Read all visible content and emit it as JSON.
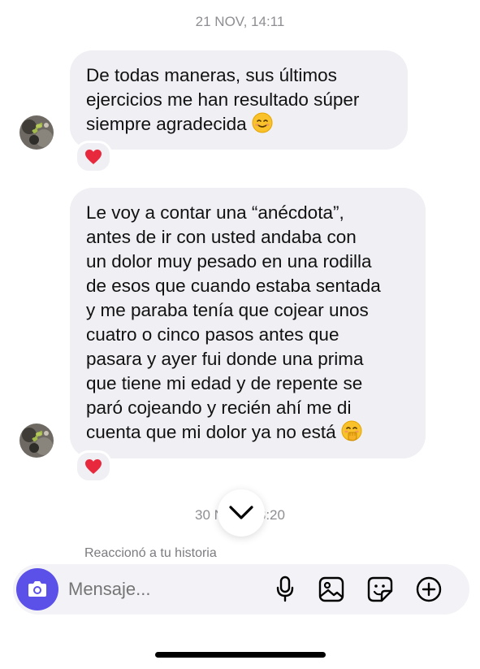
{
  "timestamps": {
    "first": "21 NOV, 14:11",
    "second": "30 NOV, 13:20"
  },
  "messages": [
    {
      "lines": [
        "De todas maneras, sus últimos",
        "ejercicios me han resultado súper",
        "siempre agradecida"
      ],
      "trailing_emoji": "smiling-face-emoji",
      "reaction": "❤️"
    },
    {
      "lines": [
        "Le voy a contar una “anécdota”,",
        "antes de ir con usted andaba con",
        "un dolor muy pesado en una rodilla",
        "de esos que cuando estaba sentada",
        "y me paraba tenía que cojear unos",
        "cuatro o cinco pasos antes que",
        "pasara y ayer fui donde una prima",
        "que tiene mi edad y de repente se",
        "paró cojeando y recién ahí me di",
        "cuenta que mi dolor ya no está"
      ],
      "trailing_emoji": "hand-over-mouth-emoji",
      "reaction": "❤️"
    }
  ],
  "story_reply": "Reaccionó a tu historia",
  "composer": {
    "placeholder": "Mensaje...",
    "icons": [
      "camera-icon",
      "microphone-icon",
      "gallery-icon",
      "sticker-icon",
      "add-icon"
    ]
  },
  "colors": {
    "bubble": "#efeff4",
    "heart": "#e8283c",
    "camera_button": "#5b51e8",
    "timestamp": "#8e8e93"
  }
}
